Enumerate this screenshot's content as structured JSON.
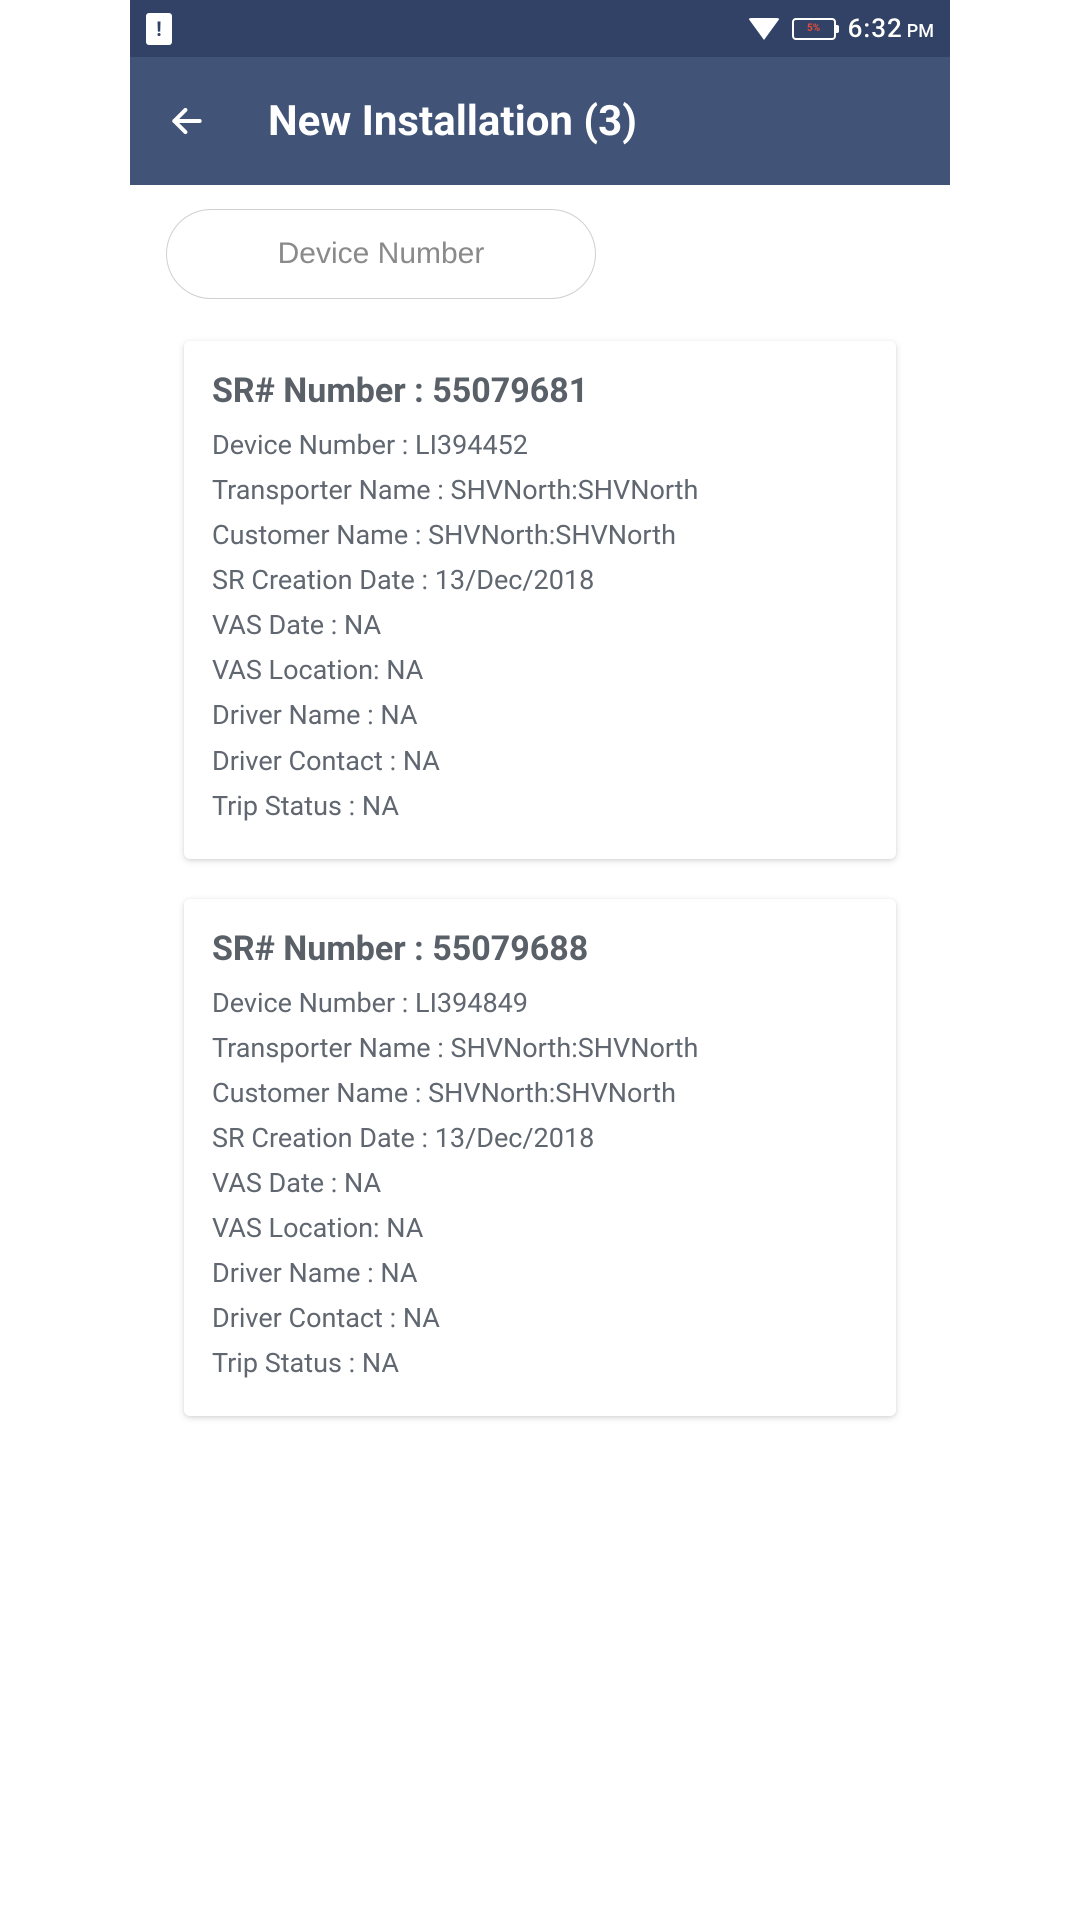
{
  "status_bar": {
    "battery_percent": "5%",
    "time": "6:32",
    "time_pm": "PM"
  },
  "header": {
    "title": "New Installation (3)"
  },
  "search": {
    "placeholder": "Device Number"
  },
  "labels": {
    "sr_number": "SR# Number : ",
    "device_number": "Device Number : ",
    "transporter_name": "Transporter Name : ",
    "customer_name": "Customer Name : ",
    "sr_creation_date": "SR Creation Date : ",
    "vas_date": "VAS Date : ",
    "vas_location": "VAS Location: ",
    "driver_name": "Driver Name : ",
    "driver_contact": "Driver Contact : ",
    "trip_status": "Trip Status : "
  },
  "cards": [
    {
      "sr_number": "55079681",
      "device_number": "LI394452",
      "transporter_name": "SHVNorth:SHVNorth",
      "customer_name": "SHVNorth:SHVNorth",
      "sr_creation_date": "13/Dec/2018",
      "vas_date": "NA",
      "vas_location": "NA",
      "driver_name": "NA",
      "driver_contact": "NA",
      "trip_status": "NA"
    },
    {
      "sr_number": "55079688",
      "device_number": "LI394849",
      "transporter_name": "SHVNorth:SHVNorth",
      "customer_name": "SHVNorth:SHVNorth",
      "sr_creation_date": "13/Dec/2018",
      "vas_date": "NA",
      "vas_location": "NA",
      "driver_name": "NA",
      "driver_contact": "NA",
      "trip_status": "NA"
    }
  ]
}
